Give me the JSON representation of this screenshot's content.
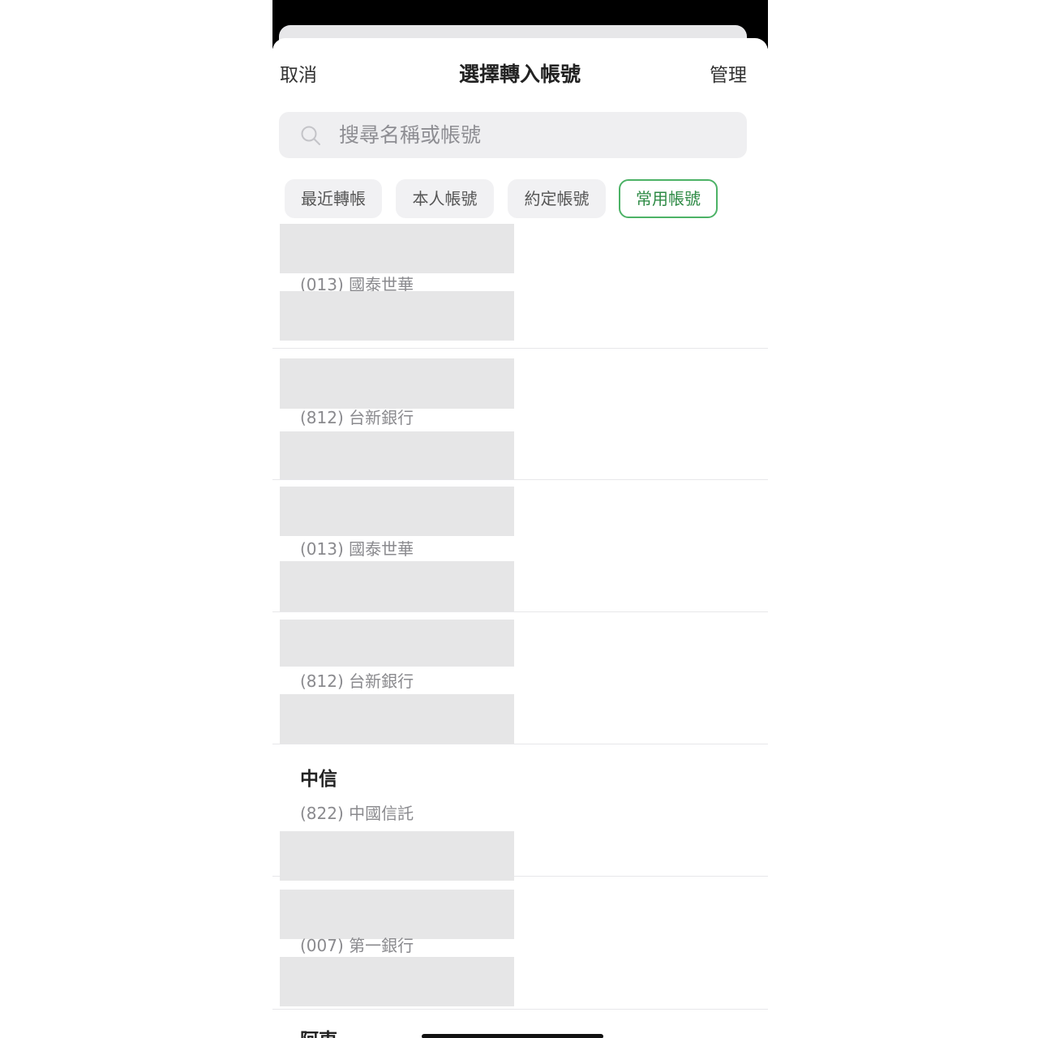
{
  "header": {
    "cancel_label": "取消",
    "title": "選擇轉入帳號",
    "manage_label": "管理"
  },
  "search": {
    "placeholder": "搜尋名稱或帳號"
  },
  "tabs": [
    {
      "label": "最近轉帳",
      "active": false
    },
    {
      "label": "本人帳號",
      "active": false
    },
    {
      "label": "約定帳號",
      "active": false
    },
    {
      "label": "常用帳號",
      "active": true
    }
  ],
  "accounts": [
    {
      "bank": "(013) 國泰世華"
    },
    {
      "bank": "(812) 台新銀行"
    },
    {
      "bank": "(013) 國泰世華"
    },
    {
      "bank": "(812) 台新銀行"
    },
    {
      "nickname": "中信",
      "bank": "(822) 中國信託"
    },
    {
      "bank": "(007) 第一銀行"
    },
    {
      "nickname": "阿東"
    }
  ],
  "colors": {
    "accent": "#4cb266",
    "mask": "#e6e6e7"
  }
}
